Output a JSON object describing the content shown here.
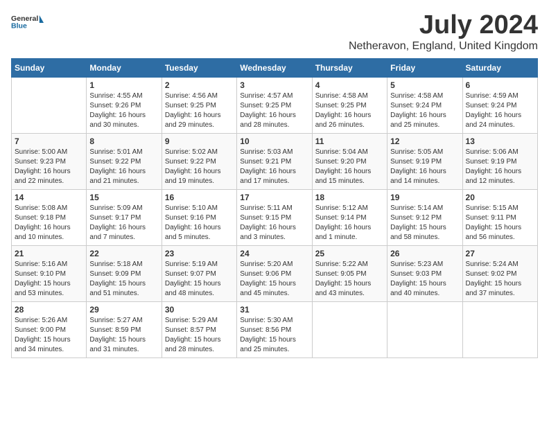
{
  "header": {
    "logo_general": "General",
    "logo_blue": "Blue",
    "month_title": "July 2024",
    "subtitle": "Netheravon, England, United Kingdom"
  },
  "days_of_week": [
    "Sunday",
    "Monday",
    "Tuesday",
    "Wednesday",
    "Thursday",
    "Friday",
    "Saturday"
  ],
  "weeks": [
    [
      {
        "day": "",
        "info": ""
      },
      {
        "day": "1",
        "info": "Sunrise: 4:55 AM\nSunset: 9:26 PM\nDaylight: 16 hours\nand 30 minutes."
      },
      {
        "day": "2",
        "info": "Sunrise: 4:56 AM\nSunset: 9:25 PM\nDaylight: 16 hours\nand 29 minutes."
      },
      {
        "day": "3",
        "info": "Sunrise: 4:57 AM\nSunset: 9:25 PM\nDaylight: 16 hours\nand 28 minutes."
      },
      {
        "day": "4",
        "info": "Sunrise: 4:58 AM\nSunset: 9:25 PM\nDaylight: 16 hours\nand 26 minutes."
      },
      {
        "day": "5",
        "info": "Sunrise: 4:58 AM\nSunset: 9:24 PM\nDaylight: 16 hours\nand 25 minutes."
      },
      {
        "day": "6",
        "info": "Sunrise: 4:59 AM\nSunset: 9:24 PM\nDaylight: 16 hours\nand 24 minutes."
      }
    ],
    [
      {
        "day": "7",
        "info": "Sunrise: 5:00 AM\nSunset: 9:23 PM\nDaylight: 16 hours\nand 22 minutes."
      },
      {
        "day": "8",
        "info": "Sunrise: 5:01 AM\nSunset: 9:22 PM\nDaylight: 16 hours\nand 21 minutes."
      },
      {
        "day": "9",
        "info": "Sunrise: 5:02 AM\nSunset: 9:22 PM\nDaylight: 16 hours\nand 19 minutes."
      },
      {
        "day": "10",
        "info": "Sunrise: 5:03 AM\nSunset: 9:21 PM\nDaylight: 16 hours\nand 17 minutes."
      },
      {
        "day": "11",
        "info": "Sunrise: 5:04 AM\nSunset: 9:20 PM\nDaylight: 16 hours\nand 15 minutes."
      },
      {
        "day": "12",
        "info": "Sunrise: 5:05 AM\nSunset: 9:19 PM\nDaylight: 16 hours\nand 14 minutes."
      },
      {
        "day": "13",
        "info": "Sunrise: 5:06 AM\nSunset: 9:19 PM\nDaylight: 16 hours\nand 12 minutes."
      }
    ],
    [
      {
        "day": "14",
        "info": "Sunrise: 5:08 AM\nSunset: 9:18 PM\nDaylight: 16 hours\nand 10 minutes."
      },
      {
        "day": "15",
        "info": "Sunrise: 5:09 AM\nSunset: 9:17 PM\nDaylight: 16 hours\nand 7 minutes."
      },
      {
        "day": "16",
        "info": "Sunrise: 5:10 AM\nSunset: 9:16 PM\nDaylight: 16 hours\nand 5 minutes."
      },
      {
        "day": "17",
        "info": "Sunrise: 5:11 AM\nSunset: 9:15 PM\nDaylight: 16 hours\nand 3 minutes."
      },
      {
        "day": "18",
        "info": "Sunrise: 5:12 AM\nSunset: 9:14 PM\nDaylight: 16 hours\nand 1 minute."
      },
      {
        "day": "19",
        "info": "Sunrise: 5:14 AM\nSunset: 9:12 PM\nDaylight: 15 hours\nand 58 minutes."
      },
      {
        "day": "20",
        "info": "Sunrise: 5:15 AM\nSunset: 9:11 PM\nDaylight: 15 hours\nand 56 minutes."
      }
    ],
    [
      {
        "day": "21",
        "info": "Sunrise: 5:16 AM\nSunset: 9:10 PM\nDaylight: 15 hours\nand 53 minutes."
      },
      {
        "day": "22",
        "info": "Sunrise: 5:18 AM\nSunset: 9:09 PM\nDaylight: 15 hours\nand 51 minutes."
      },
      {
        "day": "23",
        "info": "Sunrise: 5:19 AM\nSunset: 9:07 PM\nDaylight: 15 hours\nand 48 minutes."
      },
      {
        "day": "24",
        "info": "Sunrise: 5:20 AM\nSunset: 9:06 PM\nDaylight: 15 hours\nand 45 minutes."
      },
      {
        "day": "25",
        "info": "Sunrise: 5:22 AM\nSunset: 9:05 PM\nDaylight: 15 hours\nand 43 minutes."
      },
      {
        "day": "26",
        "info": "Sunrise: 5:23 AM\nSunset: 9:03 PM\nDaylight: 15 hours\nand 40 minutes."
      },
      {
        "day": "27",
        "info": "Sunrise: 5:24 AM\nSunset: 9:02 PM\nDaylight: 15 hours\nand 37 minutes."
      }
    ],
    [
      {
        "day": "28",
        "info": "Sunrise: 5:26 AM\nSunset: 9:00 PM\nDaylight: 15 hours\nand 34 minutes."
      },
      {
        "day": "29",
        "info": "Sunrise: 5:27 AM\nSunset: 8:59 PM\nDaylight: 15 hours\nand 31 minutes."
      },
      {
        "day": "30",
        "info": "Sunrise: 5:29 AM\nSunset: 8:57 PM\nDaylight: 15 hours\nand 28 minutes."
      },
      {
        "day": "31",
        "info": "Sunrise: 5:30 AM\nSunset: 8:56 PM\nDaylight: 15 hours\nand 25 minutes."
      },
      {
        "day": "",
        "info": ""
      },
      {
        "day": "",
        "info": ""
      },
      {
        "day": "",
        "info": ""
      }
    ]
  ]
}
